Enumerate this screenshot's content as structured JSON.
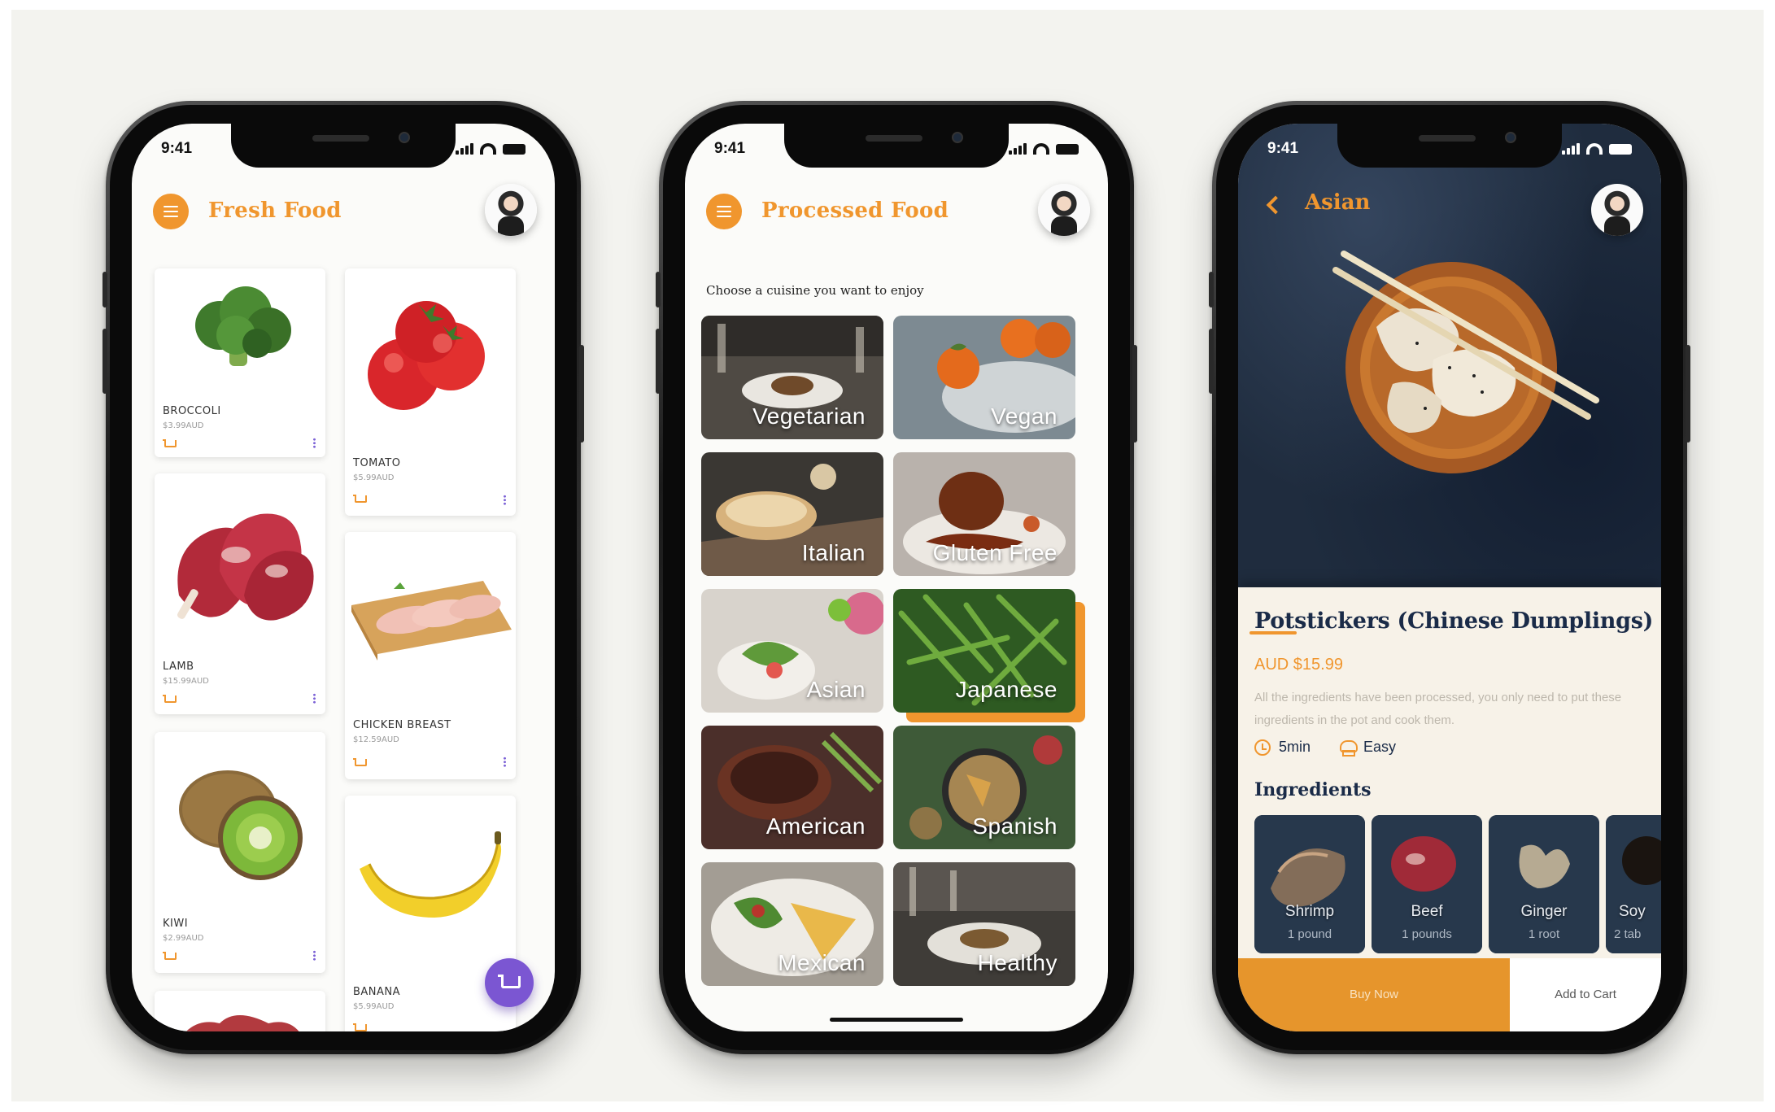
{
  "status": {
    "time": "9:41"
  },
  "fresh": {
    "title": "Fresh Food",
    "products": [
      {
        "name": "BROCCOLI",
        "price": "$3.99AUD"
      },
      {
        "name": "TOMATO",
        "price": "$5.99AUD"
      },
      {
        "name": "LAMB",
        "price": "$15.99AUD"
      },
      {
        "name": "CHICKEN BREAST",
        "price": "$12.59AUD"
      },
      {
        "name": "KIWI",
        "price": "$2.99AUD"
      },
      {
        "name": "BANANA",
        "price": "$5.99AUD"
      }
    ]
  },
  "processed": {
    "title": "Processed Food",
    "subtitle": "Choose a cuisine you want to enjoy",
    "cuisines": [
      {
        "label": "Vegetarian"
      },
      {
        "label": "Vegan"
      },
      {
        "label": "Italian"
      },
      {
        "label": "Gluten Free"
      },
      {
        "label": "Asian"
      },
      {
        "label": "Japanese",
        "selected": true
      },
      {
        "label": "American"
      },
      {
        "label": "Spanish"
      },
      {
        "label": "Mexican"
      },
      {
        "label": "Healthy"
      }
    ]
  },
  "detail": {
    "category": "Asian",
    "dish_name": "Potstickers (Chinese Dumplings)",
    "price": "AUD $15.99",
    "description": "All the ingredients have been processed, you only need to put these ingredients in the pot and cook them.",
    "time": "5min",
    "difficulty": "Easy",
    "ingredients_title": "Ingredients",
    "ingredients": [
      {
        "name": "Shrimp",
        "qty": "1 pound"
      },
      {
        "name": "Beef",
        "qty": "1 pounds"
      },
      {
        "name": "Ginger",
        "qty": "1 root"
      },
      {
        "name": "Soy",
        "qty": "2 tab"
      }
    ],
    "buy_now": "Buy Now",
    "add_to_cart": "Add to Cart"
  },
  "colors": {
    "accent": "#f0962e",
    "fab": "#7b56d2",
    "navy": "#1a2b48",
    "card_cream": "#f7f2e8"
  }
}
